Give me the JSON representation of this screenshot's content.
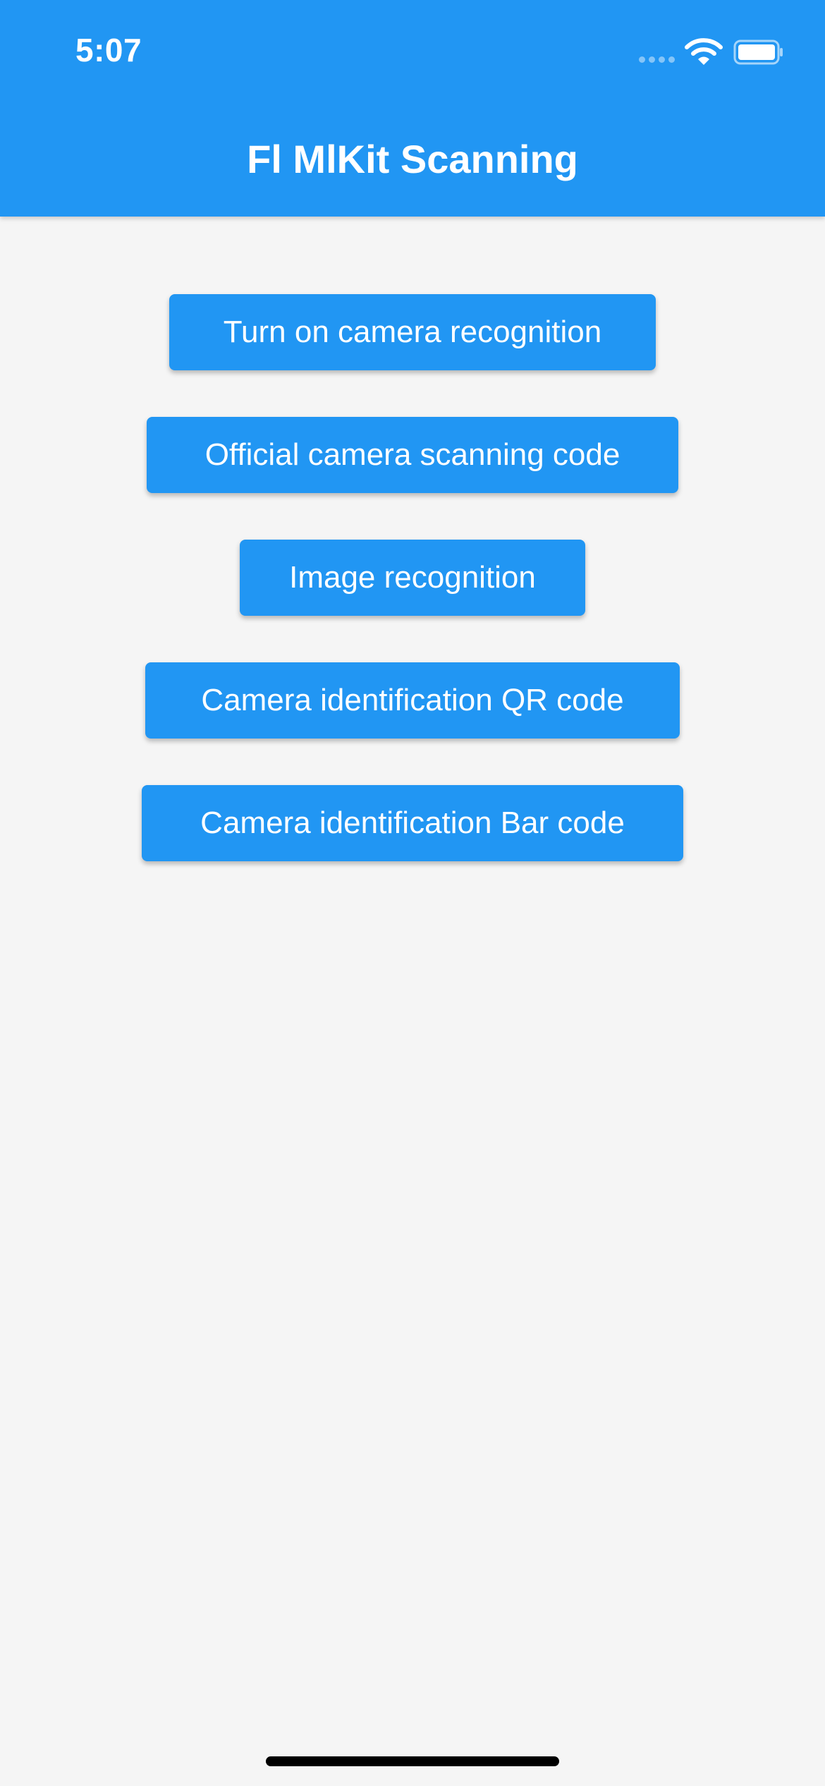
{
  "status_bar": {
    "time": "5:07"
  },
  "app_bar": {
    "title": "Fl MlKit Scanning",
    "color": "#2196f3"
  },
  "buttons": [
    "Turn on camera recognition",
    "Official camera scanning code",
    "Image recognition",
    "Camera identification QR code",
    "Camera identification Bar code"
  ],
  "colors": {
    "primary": "#2196f3",
    "background": "#f5f5f5",
    "text_on_primary": "#ffffff"
  }
}
